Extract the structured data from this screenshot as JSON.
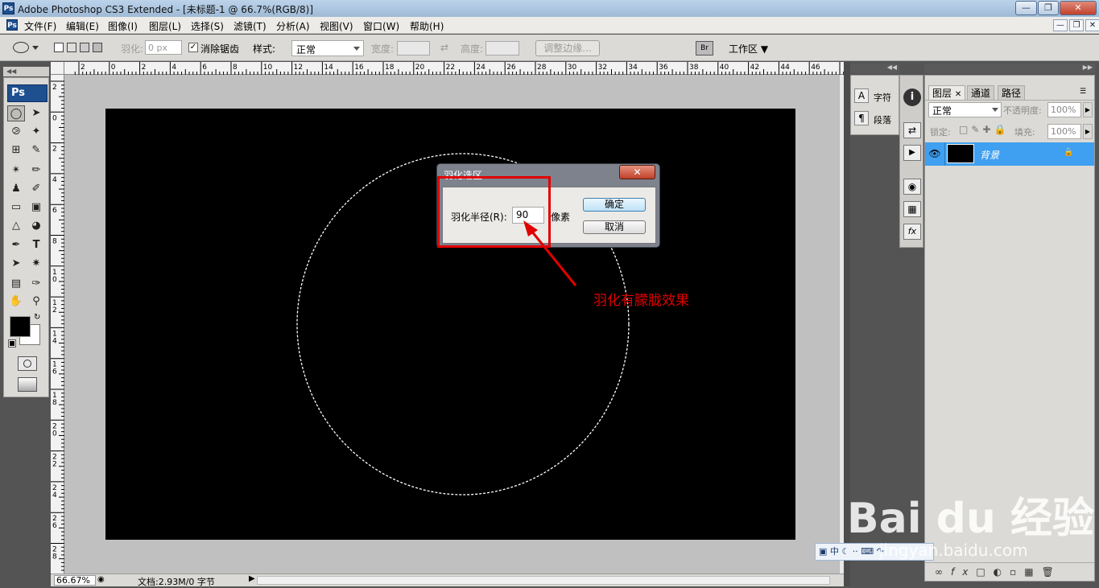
{
  "titlebar": {
    "logo": "Ps",
    "title": "Adobe Photoshop CS3 Extended - [未标题-1 @ 66.7%(RGB/8)]"
  },
  "menubar": {
    "logo": "Ps",
    "items": [
      "文件(F)",
      "编辑(E)",
      "图像(I)",
      "图层(L)",
      "选择(S)",
      "滤镜(T)",
      "分析(A)",
      "视图(V)",
      "窗口(W)",
      "帮助(H)"
    ]
  },
  "options": {
    "feather_label": "羽化:",
    "feather_value": "0 px",
    "antialias_label": "消除锯齿",
    "antialias_checked": true,
    "style_label": "样式:",
    "style_value": "正常",
    "width_label": "宽度:",
    "height_label": "高度:",
    "refine_edge_button": "调整边缘...",
    "workspace_button": "工作区"
  },
  "ruler_h": [
    "2",
    "0",
    "2",
    "4",
    "6",
    "8",
    "10",
    "12",
    "14",
    "16",
    "18",
    "20",
    "22",
    "24",
    "26",
    "28",
    "30",
    "32",
    "34",
    "36",
    "38",
    "40",
    "42",
    "44",
    "46"
  ],
  "ruler_v": [
    "2",
    "0",
    "2",
    "4",
    "6",
    "8",
    "1\n0",
    "1\n2",
    "1\n4",
    "1\n6",
    "1\n8",
    "2\n0",
    "2\n2",
    "2\n4",
    "2\n6",
    "2\n8",
    "3"
  ],
  "toolbox": {
    "logo": "Ps"
  },
  "status": {
    "zoom": "66.67%",
    "doc": "文档:2.93M/0 字节"
  },
  "char_panel": {
    "char_label": "字符",
    "para_label": "段落"
  },
  "layers_panel": {
    "tabs": [
      "图层",
      "通道",
      "路径"
    ],
    "blend_mode": "正常",
    "opacity_label": "不透明度:",
    "opacity_value": "100%",
    "lock_label": "锁定:",
    "fill_label": "填充:",
    "fill_value": "100%",
    "layer_name": "背景"
  },
  "dialog": {
    "title": "羽化选区",
    "radius_label": "羽化半径(R):",
    "radius_value": "90",
    "unit": "像素",
    "ok": "确定",
    "cancel": "取消"
  },
  "annotation": {
    "text": "羽化有朦胧效果"
  },
  "watermark": {
    "logo": "Bai  du 经验",
    "url": "jingyan.baidu.com"
  },
  "colors": {
    "accent_red": "#e00000",
    "layer_selected": "#3f9ff0",
    "image_bg": "#000000"
  }
}
